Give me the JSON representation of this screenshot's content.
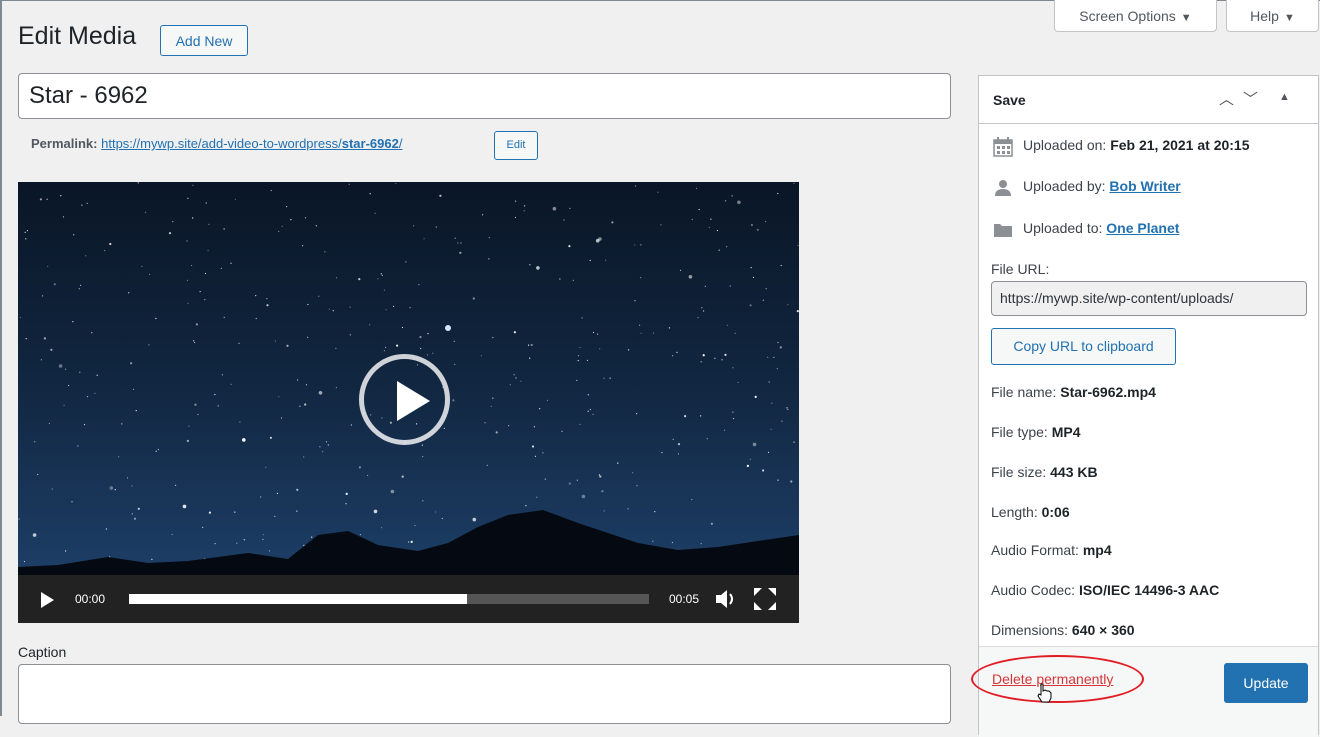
{
  "header": {
    "title": "Edit Media",
    "add_new_label": "Add New",
    "screen_options_label": "Screen Options",
    "help_label": "Help"
  },
  "post": {
    "title_value": "Star - 6962",
    "permalink_label": "Permalink:",
    "permalink_base": "https://mywp.site/add-video-to-wordpress/",
    "permalink_slug": "star-6962",
    "permalink_trailing": "/",
    "edit_label": "Edit"
  },
  "player": {
    "current_time": "00:00",
    "duration": "00:05",
    "progress": 0.65
  },
  "caption": {
    "label": "Caption",
    "value": ""
  },
  "sidebar": {
    "title": "Save",
    "uploaded_on_label": "Uploaded on:",
    "uploaded_on_value": "Feb 21, 2021 at 20:15",
    "uploaded_by_label": "Uploaded by:",
    "uploaded_by_value": "Bob Writer",
    "uploaded_to_label": "Uploaded to:",
    "uploaded_to_value": "One Planet",
    "file_url_label": "File URL:",
    "file_url_value": "https://mywp.site/wp-content/uploads/",
    "copy_url_label": "Copy URL to clipboard",
    "file_name_label": "File name:",
    "file_name_value": "Star-6962.mp4",
    "file_type_label": "File type:",
    "file_type_value": "MP4",
    "file_size_label": "File size:",
    "file_size_value": "443 KB",
    "length_label": "Length:",
    "length_value": "0:06",
    "audio_format_label": "Audio Format:",
    "audio_format_value": "mp4",
    "audio_codec_label": "Audio Codec:",
    "audio_codec_value": "ISO/IEC 14496-3 AAC",
    "dimensions_label": "Dimensions:",
    "dimensions_value": "640 × 360",
    "delete_label": "Delete permanently",
    "update_label": "Update"
  },
  "colors": {
    "accent": "#2271b1",
    "delete": "#d63638",
    "highlight_ellipse": "#e11d24"
  }
}
